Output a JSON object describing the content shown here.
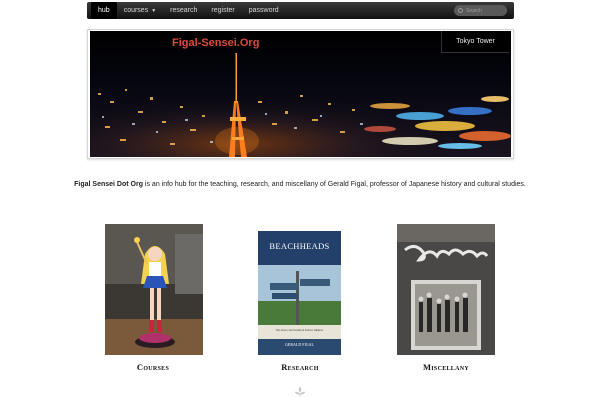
{
  "nav": {
    "items": [
      {
        "label": "hub",
        "active": true
      },
      {
        "label": "courses",
        "has_dropdown": true
      },
      {
        "label": "research"
      },
      {
        "label": "register"
      },
      {
        "label": "password"
      }
    ],
    "search_placeholder": "Search",
    "colors": {
      "bar": "#1a1a1a",
      "active": "#000000"
    }
  },
  "hero": {
    "site_title": "Figal-Sensei.Org",
    "caption": "Tokyo Tower",
    "title_color": "#e04a3c"
  },
  "intro": {
    "bold": "Figal Sensei Dot Org",
    "text": " is an info hub for the teaching, research, and miscellany of Gerald Figal, professor of Japanese history and cultural studies."
  },
  "cards": [
    {
      "label": "Courses",
      "image": "sailor-moon-figure"
    },
    {
      "label": "Research",
      "image": "beachheads-book-cover"
    },
    {
      "label": "Miscellany",
      "image": "tshirt-photo"
    }
  ],
  "book": {
    "title": "BEACHHEADS",
    "subtitle": "War, Peace, and Tourism in Postwar Okinawa",
    "author": "GERALD FIGAL"
  }
}
